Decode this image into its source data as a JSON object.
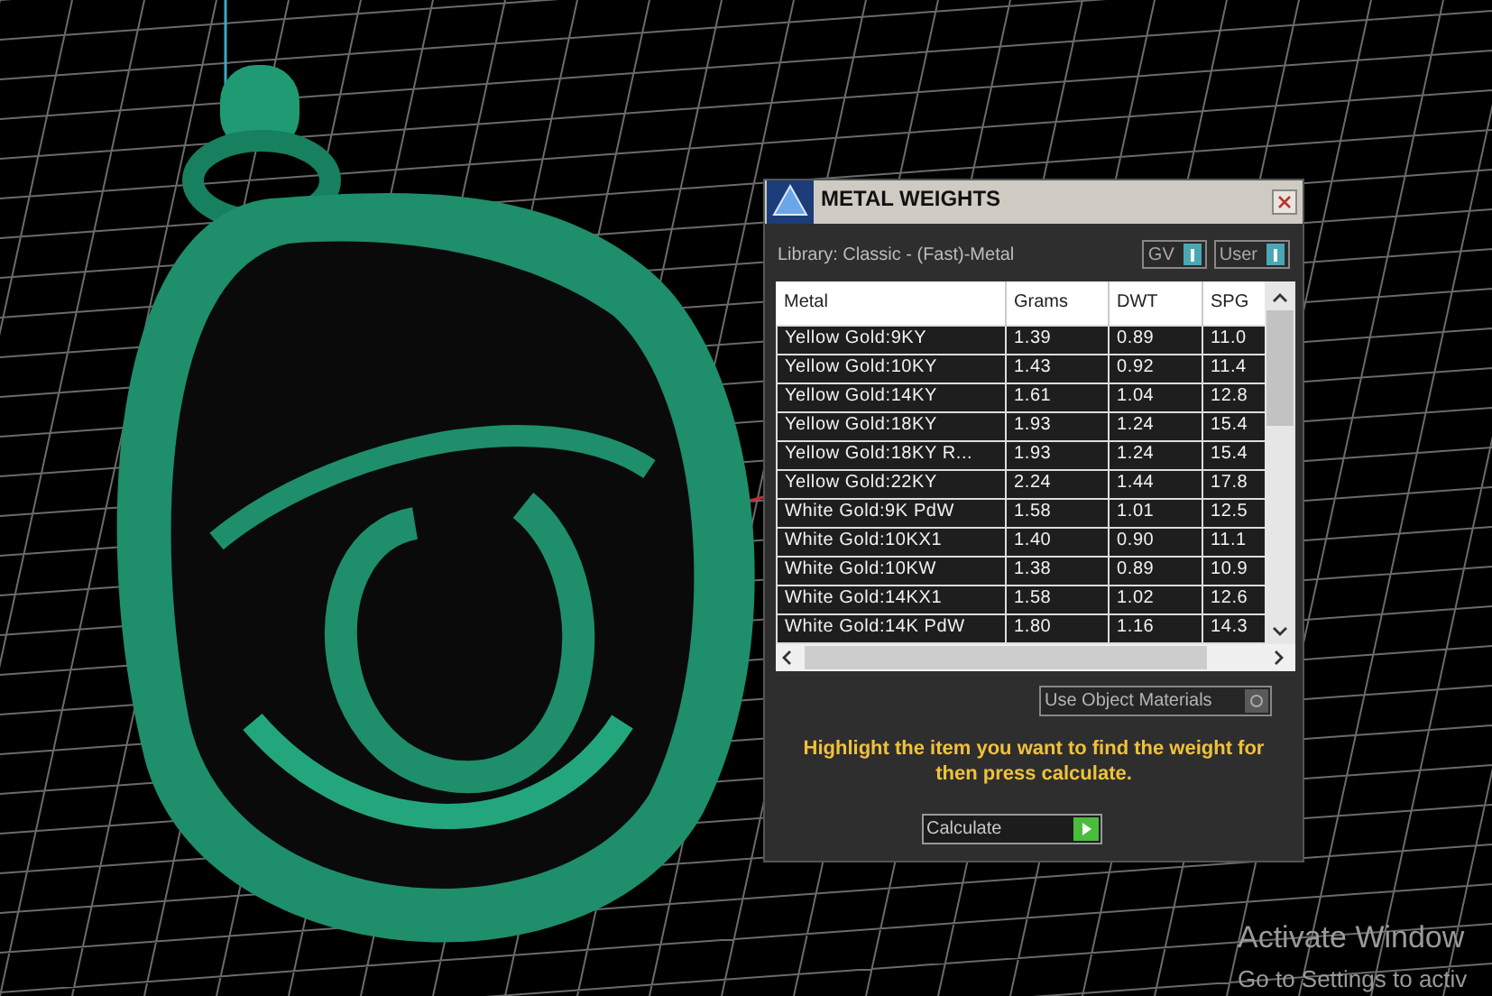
{
  "dialog": {
    "title": "METAL WEIGHTS",
    "library": "Library: Classic - (Fast)-Metal",
    "toggles": [
      {
        "label": "GV",
        "on": true
      },
      {
        "label": "User",
        "on": true
      }
    ],
    "table": {
      "columns": [
        "Metal",
        "Grams",
        "DWT",
        "SPG"
      ],
      "rows": [
        [
          "Yellow Gold:9KY",
          "1.39",
          "0.89",
          "11.0"
        ],
        [
          "Yellow Gold:10KY",
          "1.43",
          "0.92",
          "11.4"
        ],
        [
          "Yellow Gold:14KY",
          "1.61",
          "1.04",
          "12.8"
        ],
        [
          "Yellow Gold:18KY",
          "1.93",
          "1.24",
          "15.4"
        ],
        [
          "Yellow Gold:18KY R...",
          "1.93",
          "1.24",
          "15.4"
        ],
        [
          "Yellow Gold:22KY",
          "2.24",
          "1.44",
          "17.8"
        ],
        [
          "White Gold:9K PdW",
          "1.58",
          "1.01",
          "12.5"
        ],
        [
          "White Gold:10KX1",
          "1.40",
          "0.90",
          "11.1"
        ],
        [
          "White Gold:10KW",
          "1.38",
          "0.89",
          "10.9"
        ],
        [
          "White Gold:14KX1",
          "1.58",
          "1.02",
          "12.6"
        ],
        [
          "White Gold:14K PdW",
          "1.80",
          "1.16",
          "14.3"
        ]
      ]
    },
    "materials": "Use Object Materials",
    "hint": "Highlight the item you want to find the weight for then press calculate.",
    "button": "Calculate"
  },
  "activation": {
    "title": "Activate Window",
    "subtitle": "Go to Settings to activ"
  }
}
